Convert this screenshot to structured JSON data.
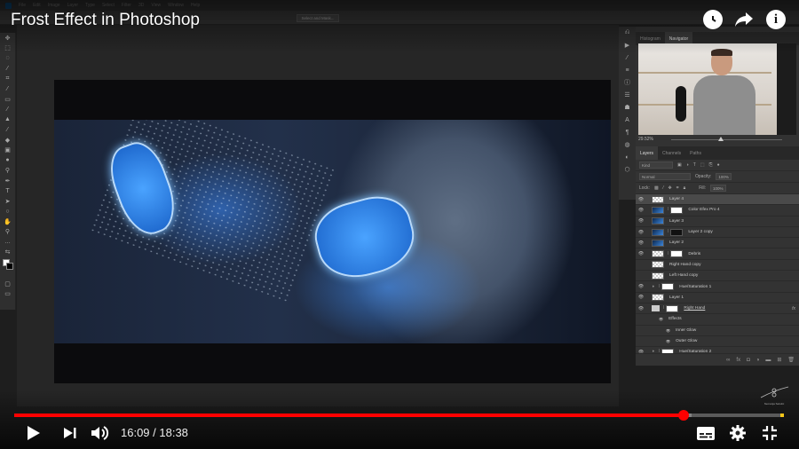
{
  "video": {
    "title": "Frost Effect in Photoshop",
    "current_time": "16:09",
    "duration": "18:38",
    "time_display": "16:09 / 18:38",
    "progress_fraction": 0.87,
    "buffered_fraction": 0.88,
    "accent_color": "#ff0000",
    "chapter_marker_color": "#f5c518",
    "top_icons": [
      "watch-later-icon",
      "share-icon",
      "info-icon"
    ],
    "controls": {
      "play": "play-icon",
      "next": "next-icon",
      "volume": "volume-icon",
      "subtitles": "subtitles-icon",
      "settings": "gear-icon",
      "exit_fullscreen": "exit-fullscreen-icon"
    },
    "watermark": "Nemanja Sekulic"
  },
  "photoshop": {
    "menu": [
      "File",
      "Edit",
      "Image",
      "Layer",
      "Type",
      "Select",
      "Filter",
      "3D",
      "View",
      "Window",
      "Help"
    ],
    "options_bar": {
      "select_and_mask": "Select and Mask..."
    },
    "navigator": {
      "tabs": [
        "Histogram",
        "Navigator"
      ],
      "active_tab": "Navigator",
      "zoom": "29.52%"
    },
    "layers_panel": {
      "tabs": [
        "Layers",
        "Channels",
        "Paths"
      ],
      "active_tab": "Layers",
      "filter_kind": "Kind",
      "blend_mode": "Normal",
      "opacity_label": "Opacity:",
      "opacity": "100%",
      "lock_label": "Lock:",
      "fill_label": "Fill:",
      "fill": "100%",
      "layers": [
        {
          "name": "Layer 4",
          "visible": true,
          "selected": true,
          "thumb": "trans"
        },
        {
          "name": "Color Efex Pro 4",
          "visible": true,
          "thumb": "blue",
          "mask": "white"
        },
        {
          "name": "Layer 3",
          "visible": true,
          "thumb": "blue"
        },
        {
          "name": "Layer 2 copy",
          "visible": true,
          "thumb": "blue",
          "mask": "black"
        },
        {
          "name": "Layer 2",
          "visible": true,
          "thumb": "blue"
        },
        {
          "name": "Debris",
          "visible": true,
          "thumb": "trans",
          "mask": "white"
        },
        {
          "name": "Right Hand copy",
          "visible": false,
          "thumb": "trans"
        },
        {
          "name": "Left Hand copy",
          "visible": false,
          "thumb": "trans"
        },
        {
          "name": "Hue/Saturation 1",
          "visible": true,
          "thumb": "adj",
          "mask": "white"
        },
        {
          "name": "Layer 1",
          "visible": true,
          "thumb": "trans"
        },
        {
          "name": "Right Hand",
          "visible": true,
          "thumb": "folder",
          "mask": "white",
          "fx": "fx"
        },
        {
          "name": "Effects",
          "visible": true,
          "sub": true
        },
        {
          "name": "Inner Glow",
          "visible": true,
          "sub": true
        },
        {
          "name": "Outer Glow",
          "visible": true,
          "sub": true
        },
        {
          "name": "Hue/Saturation 2",
          "visible": true,
          "thumb": "adj",
          "mask": "white"
        }
      ]
    }
  }
}
